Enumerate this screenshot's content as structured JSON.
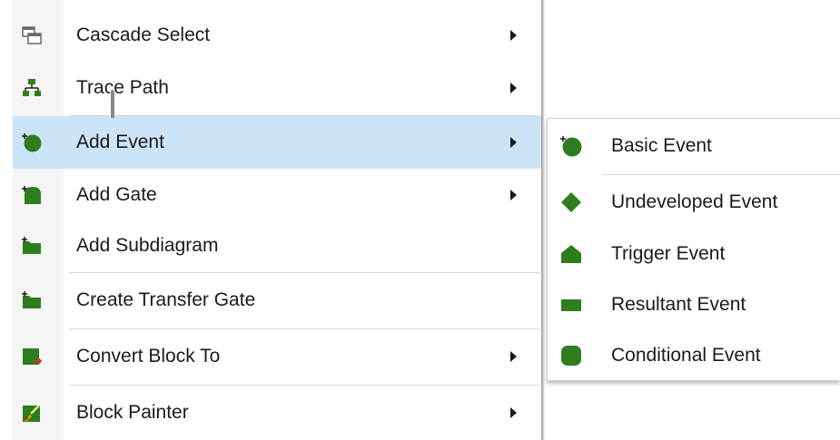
{
  "context_menu": {
    "items": [
      {
        "label": "Cascade Select",
        "icon": "cascade-windows-icon",
        "has_submenu": true
      },
      {
        "label": "Trace Path",
        "icon": "hierarchy-tree-icon",
        "has_submenu": true
      },
      {
        "label": "Add Event",
        "icon": "add-event-circle-icon",
        "has_submenu": true,
        "highlighted": true
      },
      {
        "label": "Add Gate",
        "icon": "add-gate-icon",
        "has_submenu": true
      },
      {
        "label": "Add Subdiagram",
        "icon": "add-subdiagram-folder-icon",
        "has_submenu": false
      },
      {
        "label": "Create Transfer Gate",
        "icon": "transfer-gate-folder-icon",
        "has_submenu": false
      },
      {
        "label": "Convert Block To",
        "icon": "convert-block-icon",
        "has_submenu": true
      },
      {
        "label": "Block Painter",
        "icon": "paint-brush-icon",
        "has_submenu": true
      }
    ]
  },
  "submenu": {
    "items": [
      {
        "label": "Basic Event",
        "icon": "circle-icon"
      },
      {
        "label": "Undeveloped Event",
        "icon": "diamond-icon"
      },
      {
        "label": "Trigger Event",
        "icon": "house-pentagon-icon"
      },
      {
        "label": "Resultant Event",
        "icon": "rectangle-icon"
      },
      {
        "label": "Conditional Event",
        "icon": "rounded-square-icon"
      }
    ]
  },
  "colors": {
    "icon_green": "#2e7d1e",
    "highlight": "#cce4f7",
    "separator": "#d6d6d6"
  }
}
